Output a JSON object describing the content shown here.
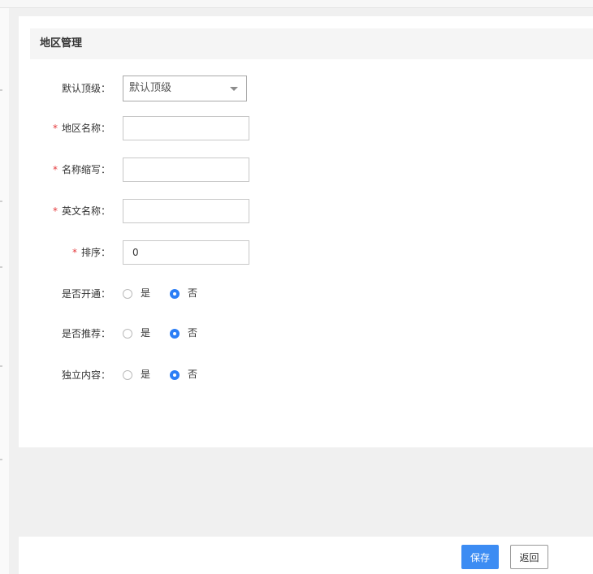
{
  "panel": {
    "title": "地区管理"
  },
  "form": {
    "parent": {
      "label": "默认顶级：",
      "selected": "默认顶级"
    },
    "name": {
      "label": "地区名称：",
      "value": "",
      "required": true
    },
    "abbr": {
      "label": "名称缩写：",
      "value": "",
      "required": true
    },
    "english": {
      "label": "英文名称：",
      "value": "",
      "required": true
    },
    "sort": {
      "label": "排序：",
      "value": "0",
      "required": true
    },
    "is_open": {
      "label": "是否开通：",
      "options": [
        "是",
        "否"
      ],
      "selected": "否"
    },
    "is_recommend": {
      "label": "是否推荐：",
      "options": [
        "是",
        "否"
      ],
      "selected": "否"
    },
    "independent": {
      "label": "独立内容：",
      "options": [
        "是",
        "否"
      ],
      "selected": "否"
    },
    "required_mark": "*"
  },
  "footer": {
    "save_label": "保存",
    "back_label": "返回"
  },
  "colors": {
    "primary": "#3c8cf3",
    "required": "#e4393c",
    "radio_checked": "#2b7ef6"
  }
}
